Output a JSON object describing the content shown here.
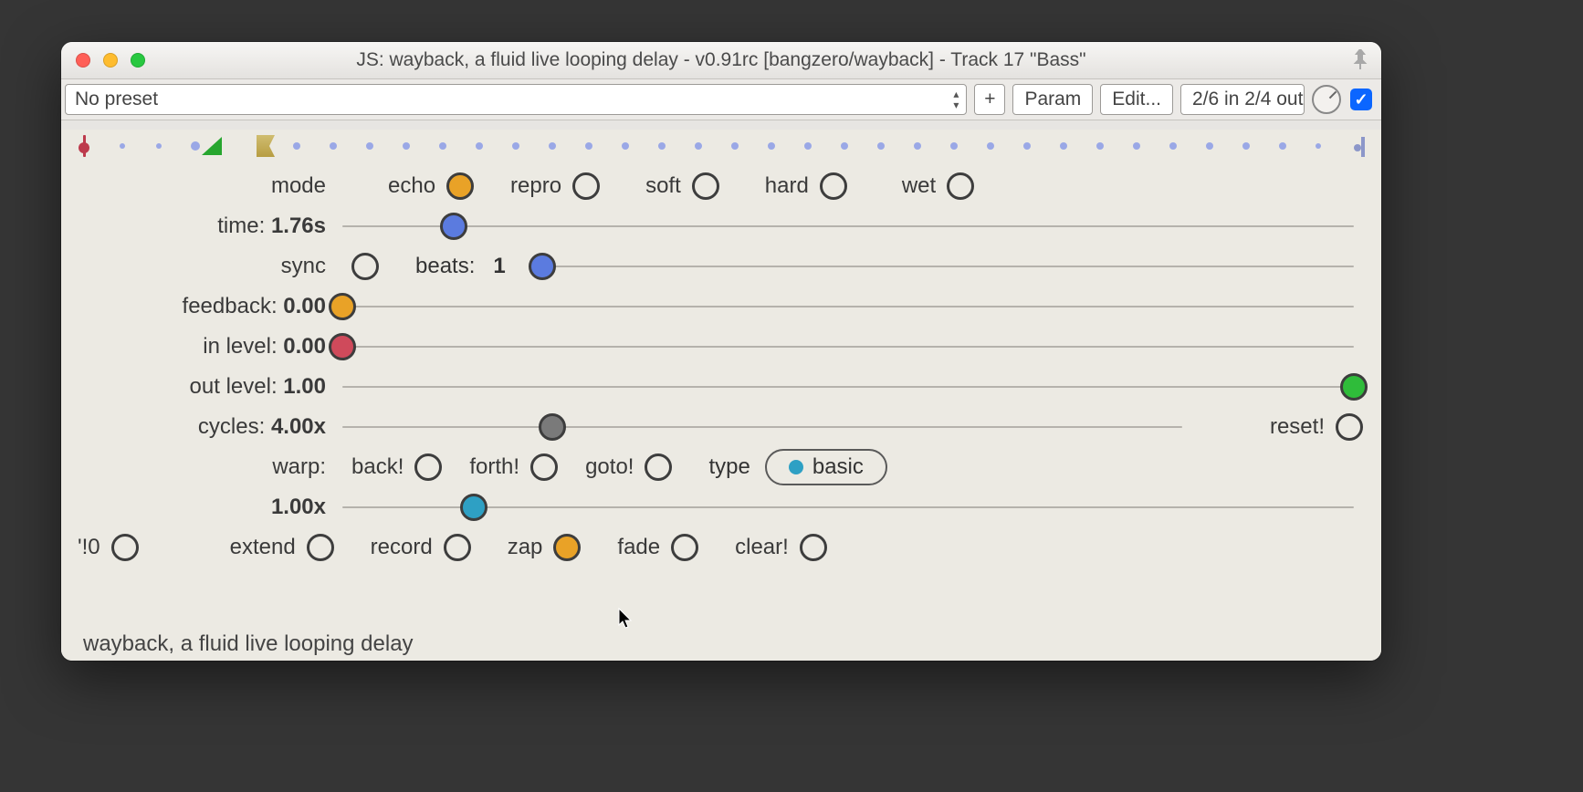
{
  "window": {
    "title": "JS: wayback, a fluid live looping delay - v0.91rc [bangzero/wayback] - Track 17 \"Bass\""
  },
  "toolbar": {
    "preset": "No preset",
    "plus": "+",
    "param": "Param",
    "edit": "Edit...",
    "routing": "2/6 in 2/4 out"
  },
  "mode": {
    "label": "mode",
    "options": {
      "echo": "echo",
      "repro": "repro",
      "soft": "soft",
      "hard": "hard",
      "wet": "wet"
    }
  },
  "time": {
    "label_prefix": "time: ",
    "value": "1.76s"
  },
  "sync": {
    "label": "sync",
    "beats_label": "beats:",
    "beats_value": "1"
  },
  "feedback": {
    "label_prefix": "feedback: ",
    "value": "0.00"
  },
  "inlevel": {
    "label_prefix": "in level: ",
    "value": "0.00"
  },
  "outlevel": {
    "label_prefix": "out level: ",
    "value": "1.00"
  },
  "cycles": {
    "label_prefix": "cycles: ",
    "value": "4.00x",
    "reset": "reset!"
  },
  "warp": {
    "label": "warp:",
    "back": "back!",
    "forth": "forth!",
    "goto": "goto!",
    "type_label": "type",
    "type_value": "basic",
    "speed": "1.00x"
  },
  "bottom": {
    "io": "'!0",
    "extend": "extend",
    "record": "record",
    "zap": "zap",
    "fade": "fade",
    "clear": "clear!"
  },
  "footer": "wayback, a fluid live looping delay"
}
